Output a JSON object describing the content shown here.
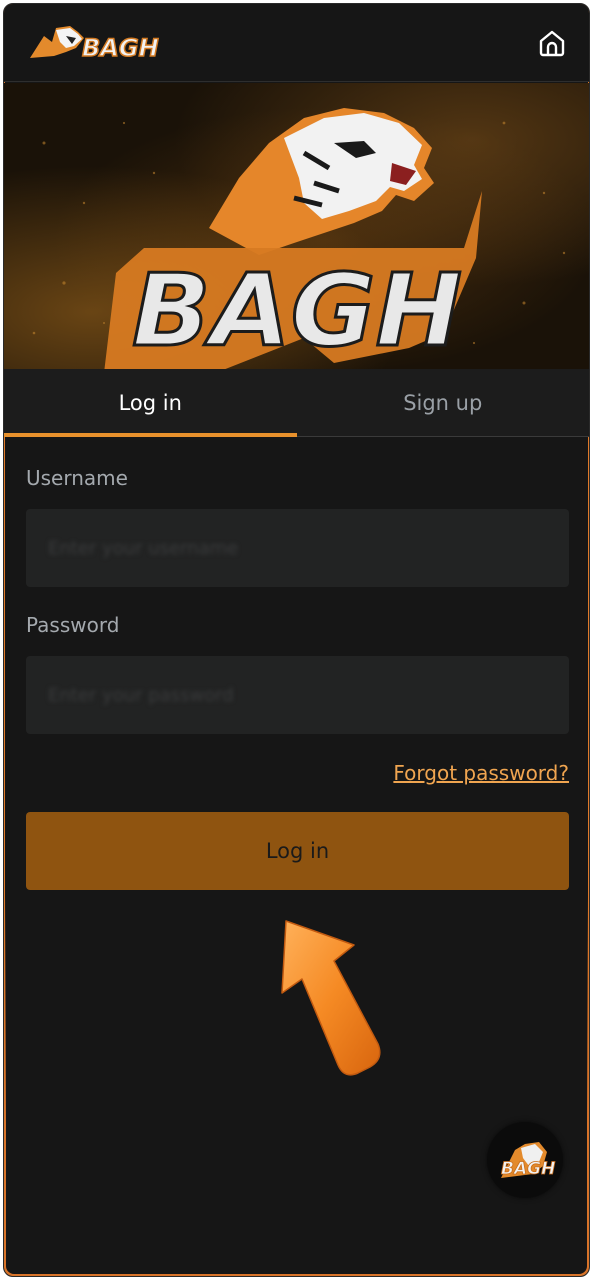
{
  "header": {
    "logo_text": "BAGH",
    "home_icon": "home-icon"
  },
  "banner": {
    "logo_text": "BAGH"
  },
  "tabs": [
    {
      "label": "Log in",
      "active": true
    },
    {
      "label": "Sign up",
      "active": false
    }
  ],
  "form": {
    "username_label": "Username",
    "username_placeholder": "Enter your username",
    "password_label": "Password",
    "password_placeholder": "Enter your password",
    "forgot_label": "Forgot password?",
    "submit_label": "Log in"
  },
  "badge": {
    "logo_text": "BAGH"
  },
  "colors": {
    "accent": "#e8912c",
    "button": "#8f5410",
    "background": "#161616",
    "link": "#f0a550"
  }
}
